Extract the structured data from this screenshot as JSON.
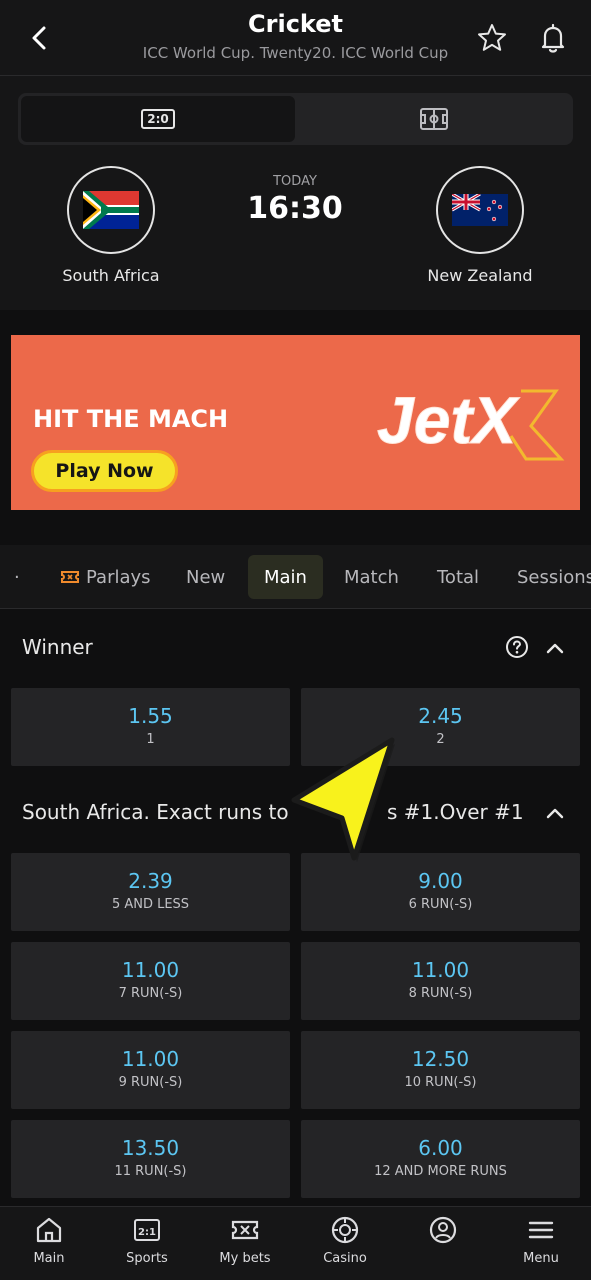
{
  "header": {
    "title": "Cricket",
    "subtitle": "ICC World Cup. Twenty20. ICC World Cup"
  },
  "match": {
    "toggle_score_icon": "2:0",
    "home_team": "South Africa",
    "away_team": "New Zealand",
    "day": "TODAY",
    "time": "16:30"
  },
  "banner": {
    "headline": "HIT THE MACH",
    "button": "Play Now",
    "logo_text": "JetX",
    "colors": {
      "background": "#ec694a",
      "button": "#f5e32a"
    }
  },
  "tabs": {
    "items": [
      "Parlays",
      "New",
      "Main",
      "Match",
      "Total",
      "Sessions"
    ],
    "active": "Main"
  },
  "winner": {
    "title": "Winner",
    "odds": [
      {
        "value": "1.55",
        "label": "1"
      },
      {
        "value": "2.45",
        "label": "2"
      }
    ]
  },
  "exact_runs": {
    "title_left": "South Africa. Exact runs to",
    "title_right": "s #1.Over #1",
    "odds": [
      {
        "value": "2.39",
        "label": "5 AND LESS"
      },
      {
        "value": "9.00",
        "label": "6 RUN(-S)"
      },
      {
        "value": "11.00",
        "label": "7 RUN(-S)"
      },
      {
        "value": "11.00",
        "label": "8 RUN(-S)"
      },
      {
        "value": "11.00",
        "label": "9 RUN(-S)"
      },
      {
        "value": "12.50",
        "label": "10 RUN(-S)"
      },
      {
        "value": "13.50",
        "label": "11 RUN(-S)"
      },
      {
        "value": "6.00",
        "label": "12 AND MORE RUNS"
      }
    ]
  },
  "bottom_nav": {
    "items": [
      "Main",
      "Sports",
      "My bets",
      "Casino",
      "",
      "Menu"
    ],
    "sports_icon": "2:1"
  },
  "colors": {
    "odds_value": "#5cc6f2",
    "background": "#0f0f10",
    "card": "#242426",
    "cursor": "#f8f21c"
  }
}
